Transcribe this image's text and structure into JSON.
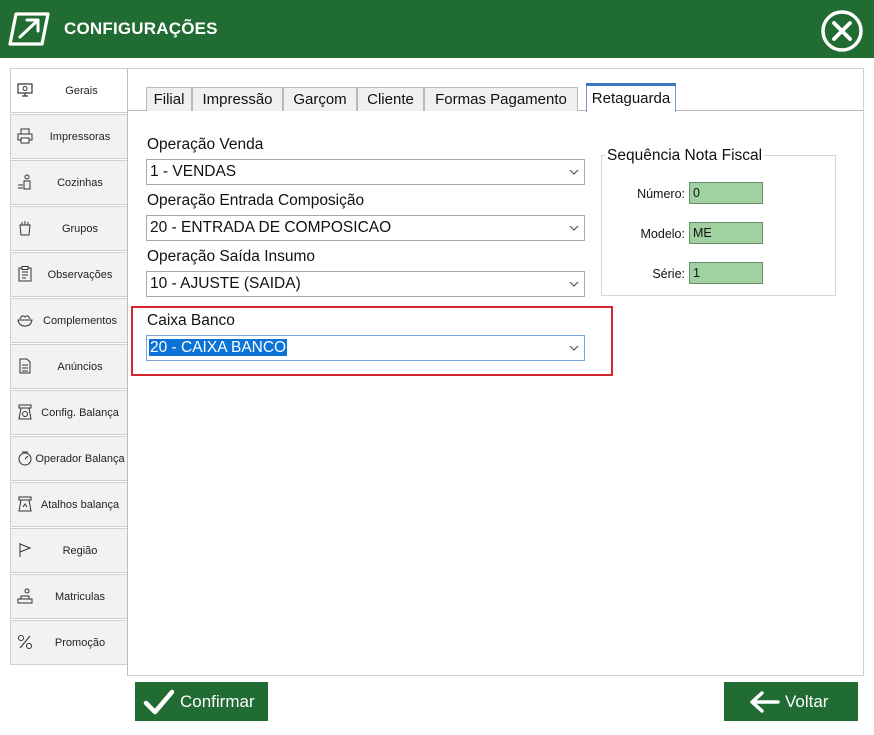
{
  "window": {
    "title": "CONFIGURAÇÕES",
    "brand_color": "#206c32",
    "close_icon": "close-circle-icon"
  },
  "sidebar": {
    "items": [
      {
        "label": "Gerais",
        "icon": "monitor-settings-icon",
        "active": true
      },
      {
        "label": "Impressoras",
        "icon": "printer-icon"
      },
      {
        "label": "Cozinhas",
        "icon": "kitchen-icon"
      },
      {
        "label": "Grupos",
        "icon": "groups-icon"
      },
      {
        "label": "Observações",
        "icon": "notes-icon"
      },
      {
        "label": "Complementos",
        "icon": "bowl-icon"
      },
      {
        "label": "Anúncios",
        "icon": "document-icon"
      },
      {
        "label": "Config. Balança",
        "icon": "scale-settings-icon"
      },
      {
        "label": "Operador  Balança",
        "icon": "scale-operator-icon"
      },
      {
        "label": "Atalhos balança",
        "icon": "scale-shortcut-icon"
      },
      {
        "label": "Região",
        "icon": "flag-icon"
      },
      {
        "label": "Matriculas",
        "icon": "registrations-icon"
      },
      {
        "label": "Promoção",
        "icon": "promotion-icon"
      }
    ]
  },
  "tabs": [
    {
      "label": "Filial"
    },
    {
      "label": "Impressão"
    },
    {
      "label": "Garçom"
    },
    {
      "label": "Cliente"
    },
    {
      "label": "Formas Pagamento"
    },
    {
      "label": "Retaguarda",
      "active": true
    }
  ],
  "form": {
    "operacao_venda": {
      "label": "Operação Venda",
      "value": "1 - VENDAS"
    },
    "operacao_entrada": {
      "label": "Operação Entrada Composição",
      "value": "20 - ENTRADA DE COMPOSICAO"
    },
    "operacao_saida": {
      "label": "Operação Saída Insumo",
      "value": "10 - AJUSTE (SAIDA)"
    },
    "caixa_banco": {
      "label": "Caixa Banco",
      "value": "20 - CAIXA BANCO"
    }
  },
  "sequencia": {
    "title": "Sequência Nota Fiscal",
    "numero_label": "Número:",
    "numero_value": "0",
    "modelo_label": "Modelo:",
    "modelo_value": "ME",
    "serie_label": "Série:",
    "serie_value": "1"
  },
  "buttons": {
    "confirm_label": "Confirmar",
    "confirm_icon": "checkmark-icon",
    "back_label": "Voltar",
    "back_icon": "arrow-left-icon"
  },
  "colors": {
    "highlight_border": "#d9252e",
    "input_fill": "#9fd1a1",
    "selection": "#0b72d6"
  }
}
